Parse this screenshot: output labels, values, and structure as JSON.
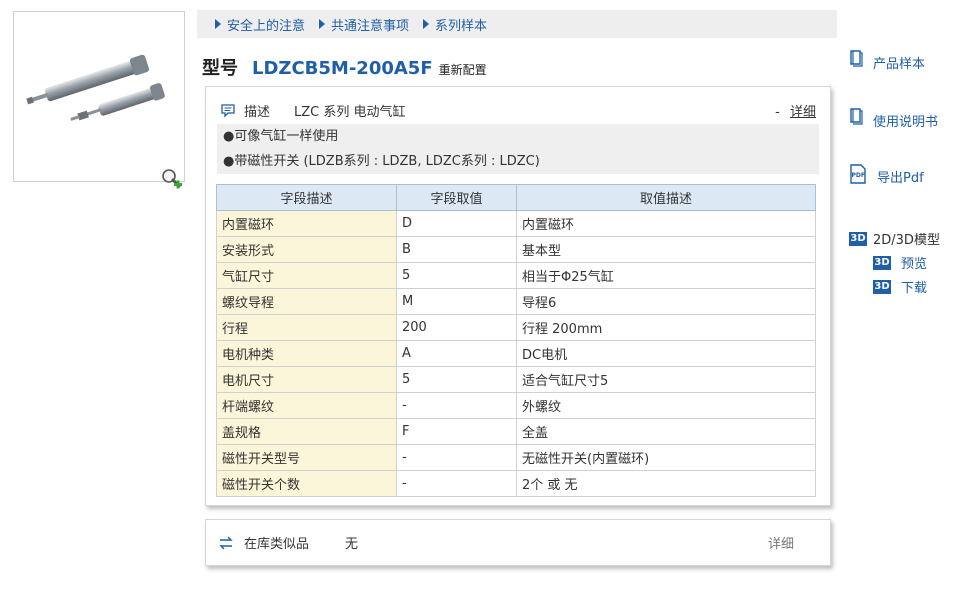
{
  "breadcrumbs": [
    {
      "label": "安全上的注意"
    },
    {
      "label": "共通注意事项"
    },
    {
      "label": "系列样本"
    }
  ],
  "title": {
    "label": "型号",
    "model": "LDZCB5M-200A5F",
    "reconfigure": "重新配置"
  },
  "description": {
    "label": "描述",
    "text": "LZC 系列 电动气缸",
    "more_prefix": "-",
    "more_link": "详细",
    "lines": [
      "●可像气缸一样使用",
      "●带磁性开关 (LDZB系列 : LDZB, LDZC系列 : LDZC)"
    ]
  },
  "table": {
    "headers": [
      "字段描述",
      "字段取值",
      "取值描述"
    ],
    "rows": [
      [
        "内置磁环",
        "D",
        "内置磁环"
      ],
      [
        "安装形式",
        "B",
        "基本型"
      ],
      [
        "气缸尺寸",
        "5",
        "相当于Φ25气缸"
      ],
      [
        "螺纹导程",
        "M",
        "导程6"
      ],
      [
        "行程",
        "200",
        "行程 200mm"
      ],
      [
        "电机种类",
        "A",
        "DC电机"
      ],
      [
        "电机尺寸",
        "5",
        "适合气缸尺寸5"
      ],
      [
        "杆端螺纹",
        "-",
        "外螺纹"
      ],
      [
        "盖规格",
        "F",
        "全盖"
      ],
      [
        "磁性开关型号",
        "-",
        "无磁性开关(内置磁环)"
      ],
      [
        "磁性开关个数",
        "-",
        "2个 或 无"
      ]
    ]
  },
  "stock": {
    "label": "在库类似品",
    "value": "无",
    "more": "详细"
  },
  "sidebar": {
    "catalog": "产品样本",
    "manual": "使用说明书",
    "export_pdf": "导出Pdf",
    "model_2d3d": "2D/3D模型",
    "preview": "预览",
    "download": "下载",
    "badge_3d": "3D"
  },
  "colors": {
    "link": "#1f5ea8",
    "header_bg": "#dce9f5",
    "first_col_bg": "#fbf6d9"
  }
}
